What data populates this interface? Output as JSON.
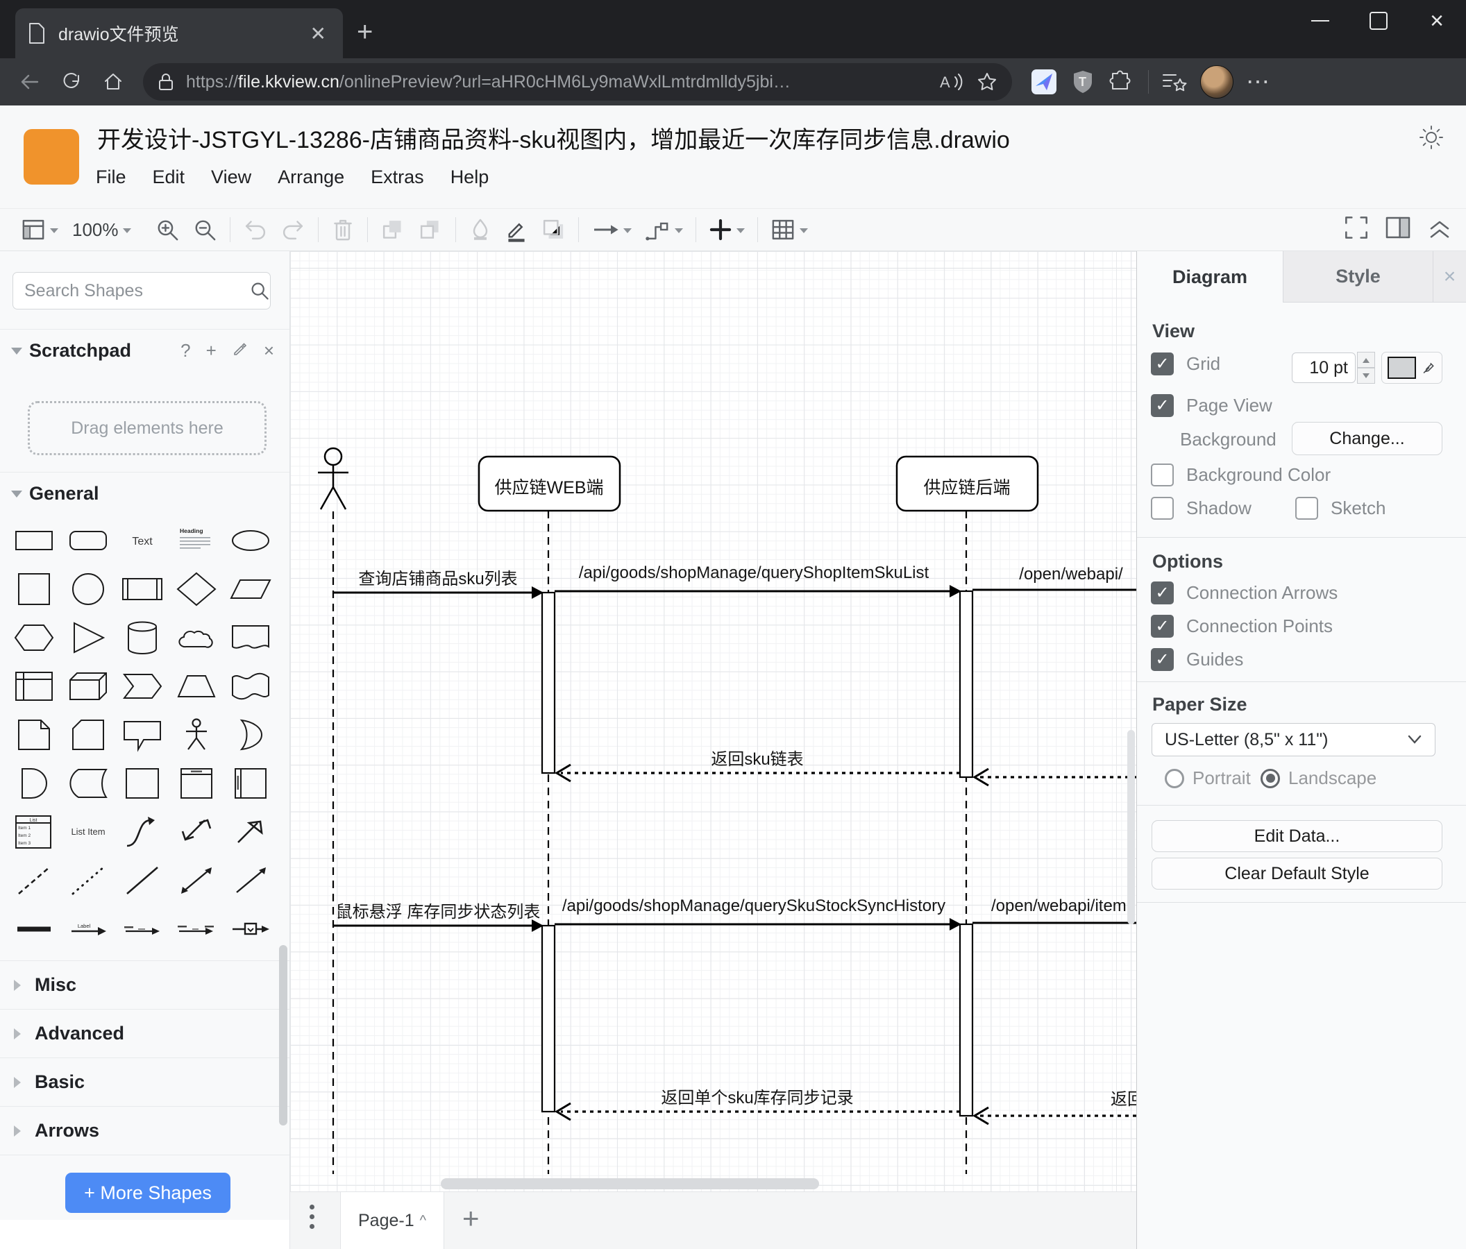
{
  "browser": {
    "tab": {
      "title": "drawio文件预览"
    },
    "address": {
      "scheme": "https://",
      "host": "file.kkview.cn",
      "path": "/onlinePreview?url=aHR0cHM6Ly9maWxlLmtrdmlldy5jbi…"
    }
  },
  "app": {
    "title": "开发设计-JSTGYL-13286-店铺商品资料-sku视图内，增加最近一次库存同步信息.drawio",
    "menus": [
      "File",
      "Edit",
      "View",
      "Arrange",
      "Extras",
      "Help"
    ],
    "toolbar": {
      "zoom": "100%"
    }
  },
  "sidebar": {
    "search": {
      "placeholder": "Search Shapes"
    },
    "scratchpad": {
      "title": "Scratchpad",
      "help": "?",
      "add": "+",
      "hint": "Drag elements here"
    },
    "general": {
      "title": "General",
      "text_shape": "Text",
      "heading_shape": "Heading",
      "list_title": "List",
      "list_items": [
        "Item 1",
        "Item 2",
        "Item 3"
      ],
      "list_item": "List Item",
      "label_arrow": "Label"
    },
    "sections": [
      "Misc",
      "Advanced",
      "Basic",
      "Arrows"
    ],
    "more_shapes": "+ More Shapes"
  },
  "canvas": {
    "participants": [
      {
        "label": "供应链WEB端"
      },
      {
        "label": "供应链后端"
      }
    ],
    "messages": [
      {
        "label": "查询店铺商品sku列表"
      },
      {
        "label": "/api/goods/shopManage/queryShopItemSkuList"
      },
      {
        "label": "/open/webapi/"
      },
      {
        "label": "返回sku链表"
      },
      {
        "label": "鼠标悬浮 库存同步状态列表"
      },
      {
        "label": "/api/goods/shopManage/querySkuStockSyncHistory"
      },
      {
        "label": "/open/webapi/item"
      },
      {
        "label": "返回单个sku库存同步记录"
      },
      {
        "label": "返回"
      }
    ]
  },
  "panel": {
    "tabs": {
      "diagram": "Diagram",
      "style": "Style"
    },
    "view": {
      "title": "View",
      "grid": "Grid",
      "grid_size": "10 pt",
      "page_view": "Page View",
      "background": "Background",
      "change": "Change...",
      "background_color": "Background Color",
      "shadow": "Shadow",
      "sketch": "Sketch"
    },
    "options": {
      "title": "Options",
      "connection_arrows": "Connection Arrows",
      "connection_points": "Connection Points",
      "guides": "Guides"
    },
    "paper": {
      "title": "Paper Size",
      "size": "US-Letter (8,5\" x 11\")",
      "portrait": "Portrait",
      "landscape": "Landscape"
    },
    "buttons": {
      "edit_data": "Edit Data...",
      "clear_default_style": "Clear Default Style"
    }
  },
  "footer": {
    "page": "Page-1"
  }
}
